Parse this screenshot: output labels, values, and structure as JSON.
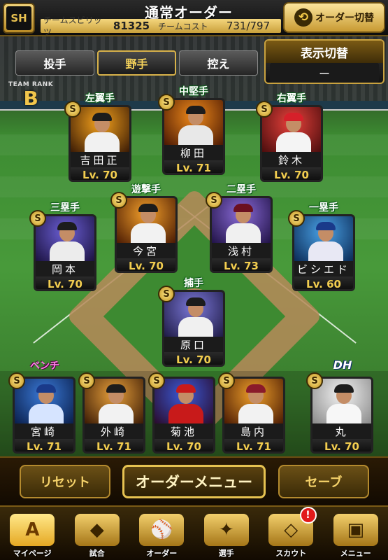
{
  "header": {
    "logo": "SH",
    "title": "通常オーダー",
    "team_spirits_label": "チームスピリッツ",
    "team_spirits_value": "81325",
    "team_cost_label": "チームコスト",
    "team_cost_value": "731/797",
    "order_switch_label": "オーダー切替"
  },
  "tabs": [
    {
      "label": "投手",
      "active": false
    },
    {
      "label": "野手",
      "active": true
    },
    {
      "label": "控え",
      "active": false
    }
  ],
  "display_switch": {
    "label": "表示切替",
    "value": "ー"
  },
  "team_rank": {
    "label": "TEAM RANK",
    "value": "B"
  },
  "lineup": [
    {
      "position": "左翼手",
      "name": "吉田正",
      "level": "Lv. 70",
      "badge": "S",
      "colors": {
        "bg1": "#f6a31c",
        "bg2": "#3a1a05",
        "uniform": "#f1f1f1",
        "cap": "#1c1c1c"
      }
    },
    {
      "position": "中堅手",
      "name": "柳田",
      "level": "Lv. 71",
      "badge": "S",
      "colors": {
        "bg1": "#f08a1a",
        "bg2": "#4a1803",
        "uniform": "#e8e8e8",
        "cap": "#1c1c1c"
      }
    },
    {
      "position": "右翼手",
      "name": "鈴木",
      "level": "Lv. 70",
      "badge": "S",
      "colors": {
        "bg1": "#e8413b",
        "bg2": "#4a0d0d",
        "uniform": "#f4f4f4",
        "cap": "#d6202a"
      }
    },
    {
      "position": "三塁手",
      "name": "岡本",
      "level": "Lv. 70",
      "badge": "S",
      "colors": {
        "bg1": "#6b5fd6",
        "bg2": "#1b123f",
        "uniform": "#ececec",
        "cap": "#1c1c1c"
      }
    },
    {
      "position": "遊撃手",
      "name": "今宮",
      "level": "Lv. 70",
      "badge": "S",
      "colors": {
        "bg1": "#f4a02a",
        "bg2": "#4a1a03",
        "uniform": "#f2f2f2",
        "cap": "#1c1c1c"
      }
    },
    {
      "position": "二塁手",
      "name": "浅村",
      "level": "Lv. 73",
      "badge": "S",
      "colors": {
        "bg1": "#8a6bd8",
        "bg2": "#201246",
        "uniform": "#f0f0f0",
        "cap": "#6b1020"
      }
    },
    {
      "position": "一塁手",
      "name": "ビシエド",
      "level": "Lv. 60",
      "badge": "S",
      "colors": {
        "bg1": "#4aa3e8",
        "bg2": "#0b2a55",
        "uniform": "#e8e8f4",
        "cap": "#1a3a8a"
      }
    },
    {
      "position": "捕手",
      "name": "原口",
      "level": "Lv. 70",
      "badge": "S",
      "colors": {
        "bg1": "#7b78d8",
        "bg2": "#1e1a45",
        "uniform": "#f0f0f0",
        "cap": "#1c1c1c"
      }
    }
  ],
  "bench": {
    "label": "ベンチ",
    "players": [
      {
        "name": "宮崎",
        "level": "Lv. 71",
        "badge": "S",
        "colors": {
          "bg1": "#3a7ad8",
          "bg2": "#0a1e4a",
          "uniform": "#d6e4ff",
          "cap": "#1a3a8a"
        }
      },
      {
        "name": "外崎",
        "level": "Lv. 71",
        "badge": "S",
        "colors": {
          "bg1": "#e8a03a",
          "bg2": "#3a1a05",
          "uniform": "#f2f2f2",
          "cap": "#1c1c1c"
        }
      },
      {
        "name": "菊池",
        "level": "Lv. 70",
        "badge": "S",
        "colors": {
          "bg1": "#3a5ad8",
          "bg2": "#2a0a2a",
          "uniform": "#c81a1a",
          "cap": "#c81a1a"
        }
      },
      {
        "name": "島内",
        "level": "Lv. 71",
        "badge": "S",
        "colors": {
          "bg1": "#f0a02a",
          "bg2": "#4a1a03",
          "uniform": "#f2f2f2",
          "cap": "#8a1a2a"
        }
      }
    ]
  },
  "dh": {
    "position": "DH",
    "name": "丸",
    "level": "Lv. 70",
    "badge": "S",
    "colors": {
      "bg1": "#f3f3f3",
      "bg2": "#8a8a8a",
      "uniform": "#f7f7f7",
      "cap": "#1c1c1c"
    }
  },
  "actions": {
    "reset": "リセット",
    "order_menu": "オーダーメニュー",
    "save": "セーブ"
  },
  "nav": [
    {
      "label": "マイページ",
      "icon": "A",
      "active": true
    },
    {
      "label": "試合",
      "icon": "◆",
      "active": false
    },
    {
      "label": "オーダー",
      "icon": "⚾",
      "active": false
    },
    {
      "label": "選手",
      "icon": "✦",
      "active": false
    },
    {
      "label": "スカウト",
      "icon": "◇",
      "active": false,
      "notice": "!"
    },
    {
      "label": "メニュー",
      "icon": "▣",
      "active": false
    }
  ]
}
